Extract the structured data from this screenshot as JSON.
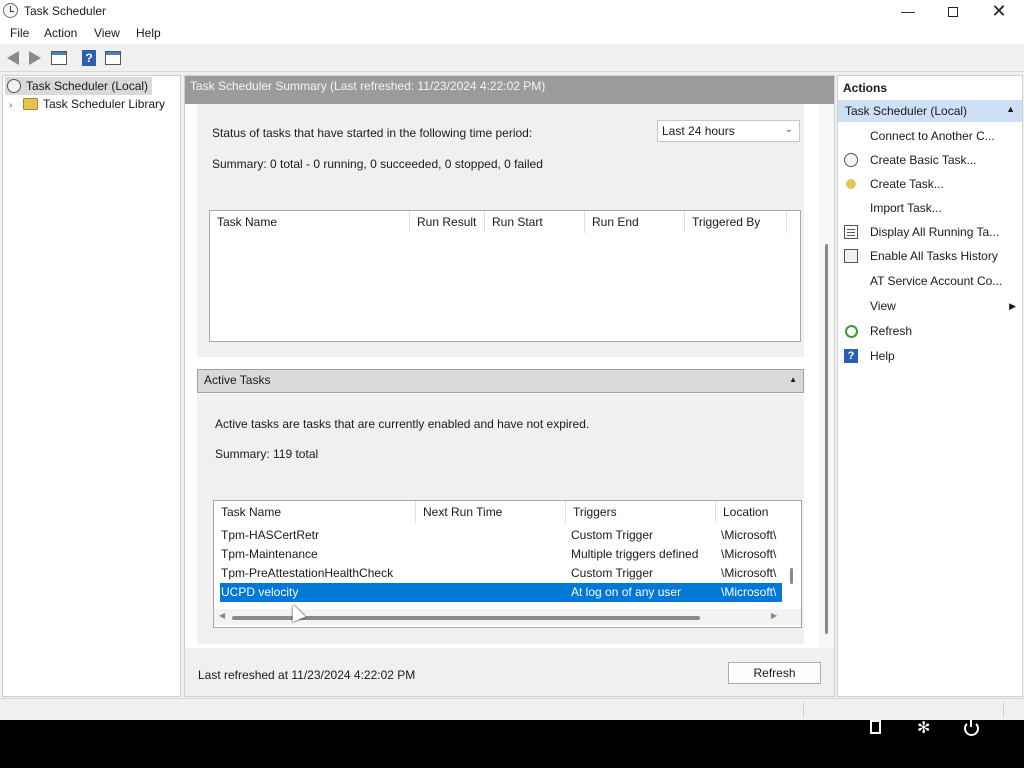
{
  "window": {
    "title": "Task Scheduler",
    "minimize_glyph": "—",
    "close_glyph": "✕"
  },
  "menu": [
    "File",
    "Action",
    "View",
    "Help"
  ],
  "toolbar": {
    "help_glyph": "?"
  },
  "tree": {
    "items": [
      {
        "label": "Task Scheduler (Local)",
        "icon": "clock-icon"
      },
      {
        "label": "Task Scheduler Library",
        "icon": "folder-icon",
        "chevron": "›"
      }
    ]
  },
  "summary": {
    "header": "Task Scheduler Summary (Last refreshed: 11/23/2024 4:22:02 PM)",
    "status_label": "Status of tasks that have started in the following time period:",
    "period_value": "Last 24 hours",
    "dropdown_arrow": "⌄",
    "summary_line": "Summary: 0 total - 0 running, 0 succeeded, 0 stopped, 0 failed",
    "status_columns": [
      "Task Name",
      "Run Result",
      "Run Start",
      "Run End",
      "Triggered By"
    ]
  },
  "active_tasks": {
    "header": "Active Tasks",
    "collapse_arrow": "▲",
    "description": "Active tasks are tasks that are currently enabled and have not expired.",
    "summary_line": "Summary: 119 total",
    "columns": [
      "Task Name",
      "Next Run Time",
      "Triggers",
      "Location"
    ],
    "rows": [
      {
        "name": "Tpm-HASCertRetr",
        "next": "",
        "triggers": "Custom Trigger",
        "location": "\\Microsoft\\"
      },
      {
        "name": "Tpm-Maintenance",
        "next": "",
        "triggers": "Multiple triggers defined",
        "location": "\\Microsoft\\"
      },
      {
        "name": "Tpm-PreAttestationHealthCheck",
        "next": "",
        "triggers": "Custom Trigger",
        "location": "\\Microsoft\\"
      },
      {
        "name": "UCPD velocity",
        "next": "",
        "triggers": "At log on of any user",
        "location": "\\Microsoft\\",
        "selected": true
      }
    ],
    "scroll_left": "◀",
    "scroll_right": "▶"
  },
  "footer": {
    "last_refreshed": "Last refreshed at 11/23/2024 4:22:02 PM",
    "refresh_button": "Refresh"
  },
  "actions": {
    "title": "Actions",
    "section": "Task Scheduler (Local)",
    "section_arrow": "▲",
    "submenu_arrow": "▶",
    "items": [
      {
        "label": "Connect to Another C...",
        "icon": "none"
      },
      {
        "label": "Create Basic Task...",
        "icon": "create-basic-task-icon"
      },
      {
        "label": "Create Task...",
        "icon": "create-task-icon"
      },
      {
        "label": "Import Task...",
        "icon": "none"
      },
      {
        "label": "Display All Running Ta...",
        "icon": "running-tasks-icon"
      },
      {
        "label": "Enable All Tasks History",
        "icon": "history-icon"
      },
      {
        "label": "AT Service Account Co...",
        "icon": "none"
      },
      {
        "label": "View",
        "icon": "none"
      },
      {
        "label": "Refresh",
        "icon": "refresh-icon"
      },
      {
        "label": "Help",
        "icon": "help-icon"
      }
    ]
  },
  "colors": {
    "selection": "#0078d7",
    "header_gray": "#9b9b9b",
    "actions_highlight": "#cde0f5"
  }
}
